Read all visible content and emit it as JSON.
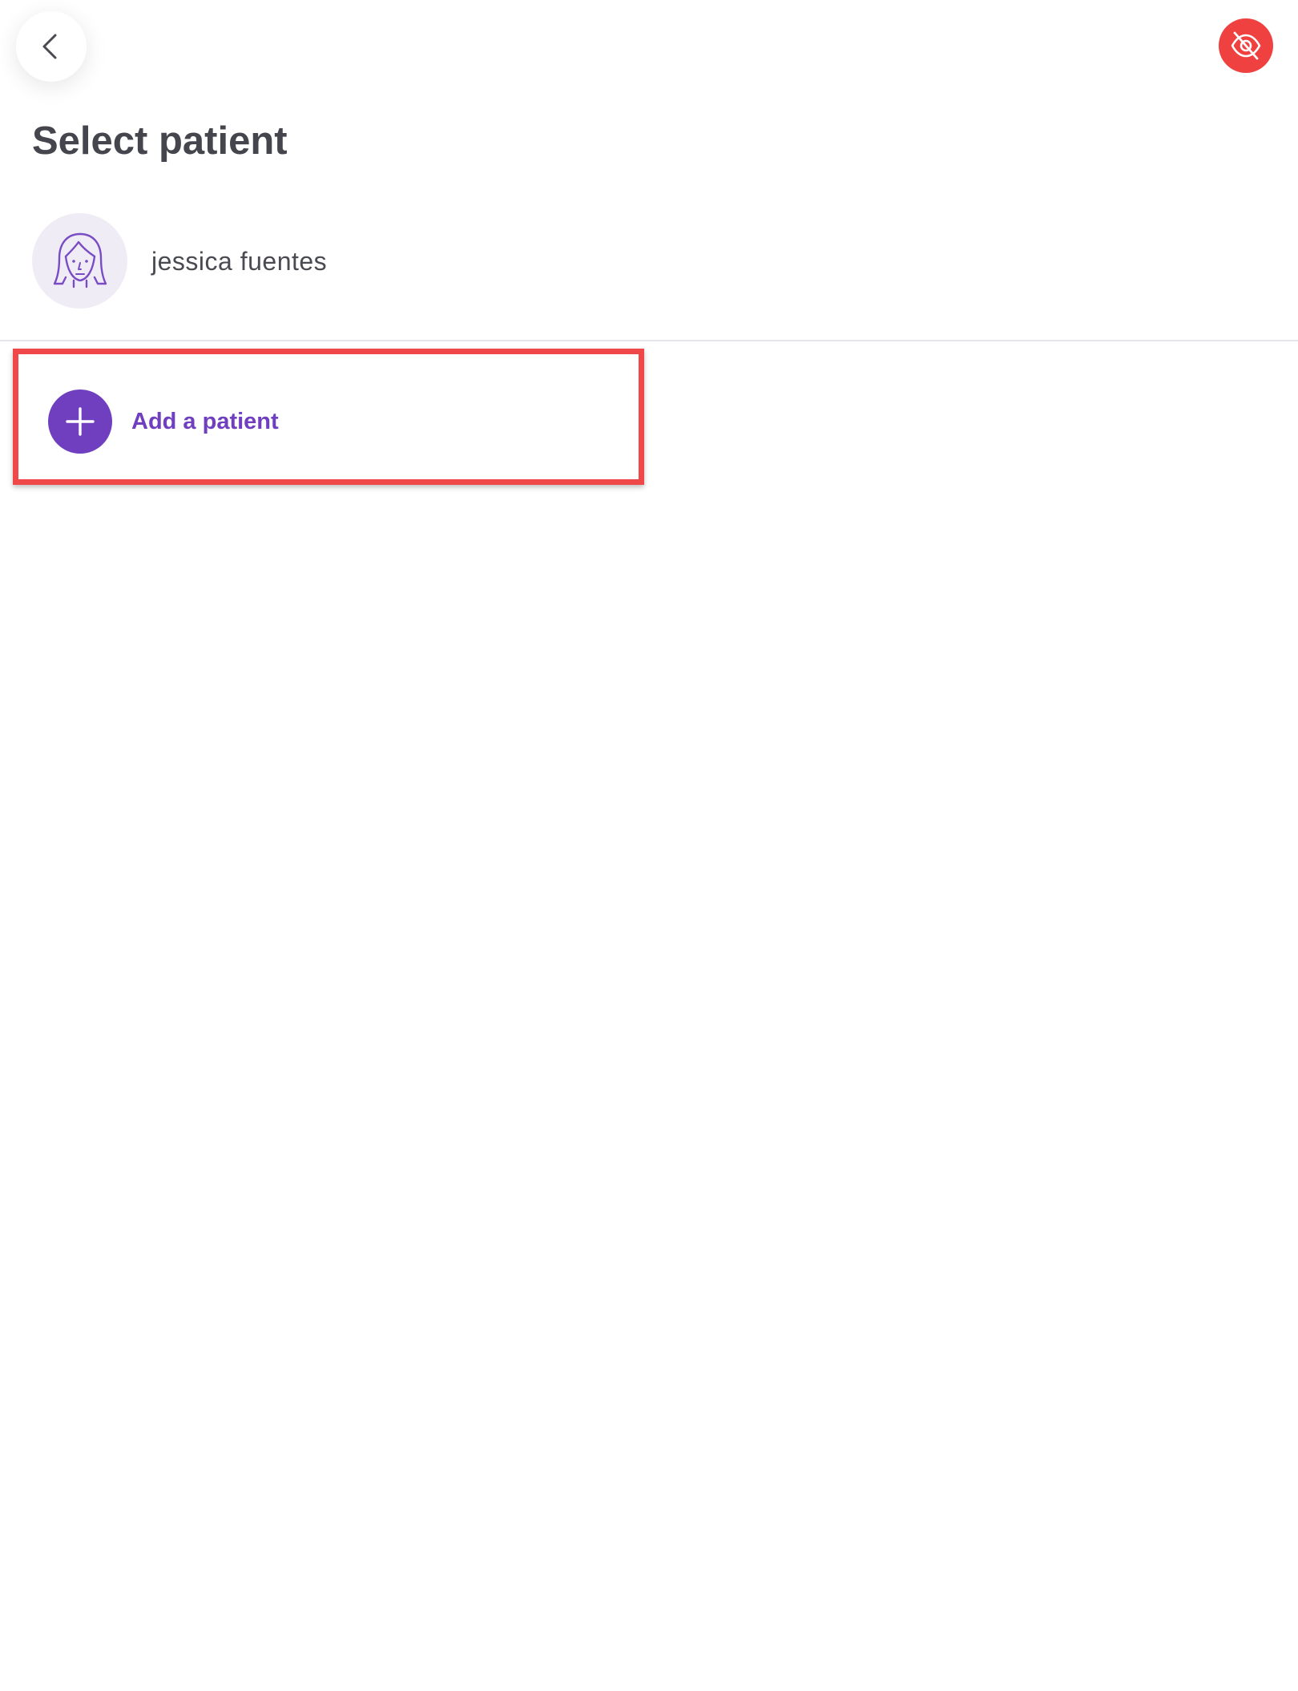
{
  "header": {
    "back_icon": "chevron-left-icon",
    "privacy_icon": "eye-off-icon",
    "privacy_color": "#f04141"
  },
  "main": {
    "title": "Select patient",
    "patients": [
      {
        "name": "jessica fuentes",
        "avatar_icon": "female-avatar-icon"
      }
    ],
    "add_patient": {
      "label": "Add a patient",
      "icon": "plus-icon",
      "accent_color": "#6f3fc0",
      "highlight_color": "#f04848"
    }
  }
}
